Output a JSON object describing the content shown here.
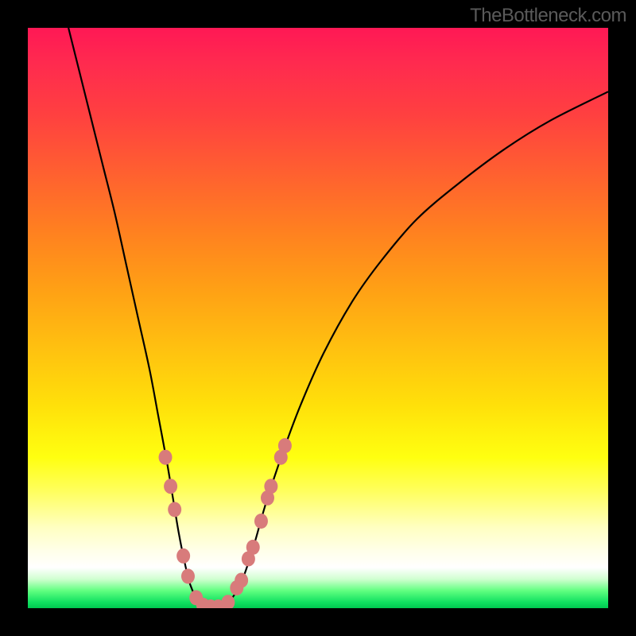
{
  "watermark": "TheBottleneck.com",
  "chart_data": {
    "type": "line",
    "title": "",
    "xlabel": "",
    "ylabel": "",
    "xlim": [
      0,
      100
    ],
    "ylim": [
      0,
      100
    ],
    "background": "gradient-red-to-green-vertical",
    "series": [
      {
        "name": "bottleneck-curve",
        "kind": "line",
        "color": "#000000",
        "points": [
          {
            "x": 7.0,
            "y": 100
          },
          {
            "x": 9.0,
            "y": 92
          },
          {
            "x": 11.0,
            "y": 84
          },
          {
            "x": 13.0,
            "y": 76
          },
          {
            "x": 15.0,
            "y": 68
          },
          {
            "x": 17.0,
            "y": 59
          },
          {
            "x": 19.0,
            "y": 50
          },
          {
            "x": 21.0,
            "y": 41
          },
          {
            "x": 22.5,
            "y": 33
          },
          {
            "x": 24.0,
            "y": 25
          },
          {
            "x": 25.0,
            "y": 19
          },
          {
            "x": 26.0,
            "y": 13
          },
          {
            "x": 27.0,
            "y": 8
          },
          {
            "x": 28.0,
            "y": 4
          },
          {
            "x": 29.5,
            "y": 1
          },
          {
            "x": 31.0,
            "y": 0.2
          },
          {
            "x": 33.0,
            "y": 0.2
          },
          {
            "x": 35.0,
            "y": 1.5
          },
          {
            "x": 37.0,
            "y": 5
          },
          {
            "x": 39.0,
            "y": 11
          },
          {
            "x": 41.0,
            "y": 18
          },
          {
            "x": 44.0,
            "y": 27
          },
          {
            "x": 47.0,
            "y": 35
          },
          {
            "x": 51.0,
            "y": 44
          },
          {
            "x": 56.0,
            "y": 53
          },
          {
            "x": 61.0,
            "y": 60
          },
          {
            "x": 67.0,
            "y": 67
          },
          {
            "x": 74.0,
            "y": 73
          },
          {
            "x": 82.0,
            "y": 79
          },
          {
            "x": 90.0,
            "y": 84
          },
          {
            "x": 100.0,
            "y": 89
          }
        ]
      },
      {
        "name": "sample-dots",
        "kind": "scatter",
        "color": "#d87b7b",
        "points": [
          {
            "x": 23.7,
            "y": 26
          },
          {
            "x": 24.6,
            "y": 21
          },
          {
            "x": 25.3,
            "y": 17
          },
          {
            "x": 26.8,
            "y": 9
          },
          {
            "x": 27.6,
            "y": 5.5
          },
          {
            "x": 29.0,
            "y": 1.8
          },
          {
            "x": 30.2,
            "y": 0.5
          },
          {
            "x": 31.5,
            "y": 0.2
          },
          {
            "x": 32.8,
            "y": 0.2
          },
          {
            "x": 34.5,
            "y": 1.0
          },
          {
            "x": 36.0,
            "y": 3.5
          },
          {
            "x": 36.8,
            "y": 4.8
          },
          {
            "x": 38.0,
            "y": 8.5
          },
          {
            "x": 38.8,
            "y": 10.5
          },
          {
            "x": 40.2,
            "y": 15
          },
          {
            "x": 41.3,
            "y": 19
          },
          {
            "x": 41.9,
            "y": 21
          },
          {
            "x": 43.6,
            "y": 26
          },
          {
            "x": 44.3,
            "y": 28
          }
        ]
      }
    ]
  }
}
